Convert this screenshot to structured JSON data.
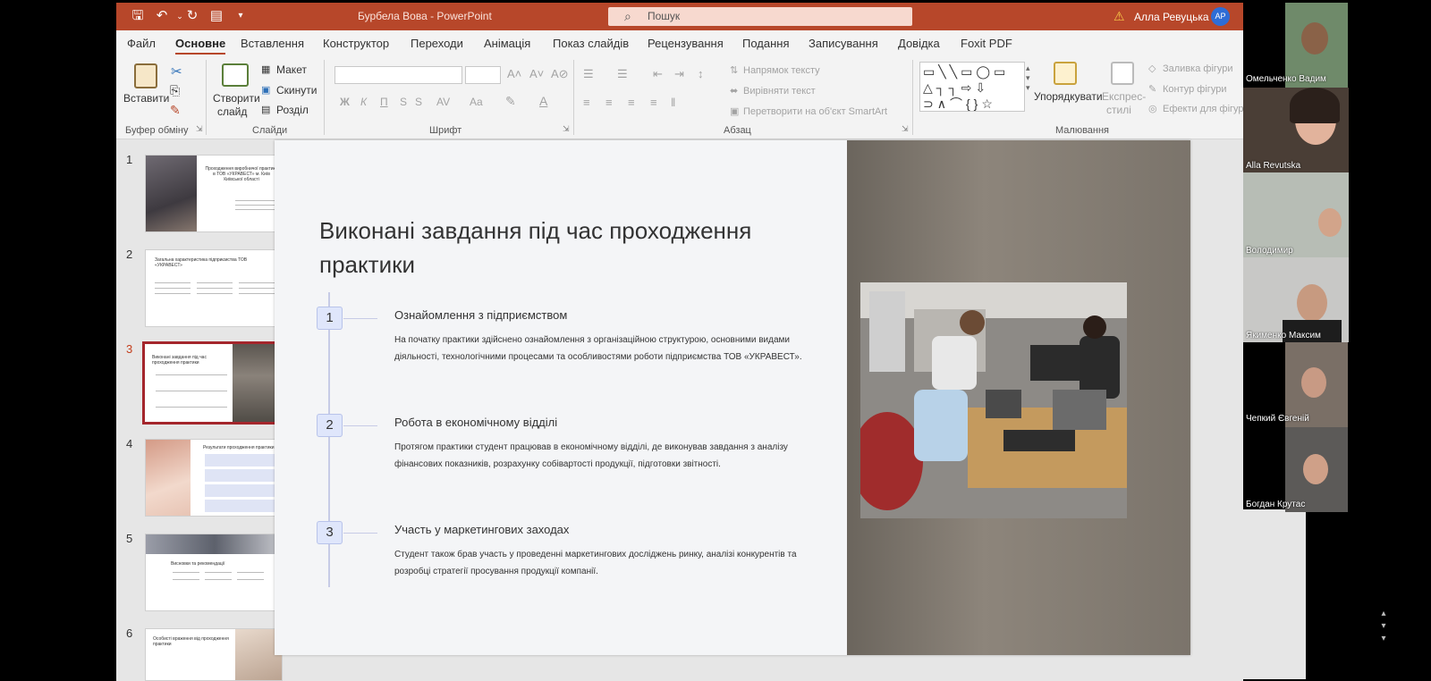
{
  "titlebar": {
    "doc_title": "Бурбела Вова  -  PowerPoint",
    "search_placeholder": "Пошук",
    "user_name": "Алла Ревуцька",
    "user_initials": "АР",
    "color": "#b7472a"
  },
  "quick_access": [
    "save-icon",
    "undo-icon",
    "redo-icon",
    "present-icon",
    "customize-icon"
  ],
  "menu_tabs": [
    "Файл",
    "Основне",
    "Вставлення",
    "Конструктор",
    "Переходи",
    "Анімація",
    "Показ слайдів",
    "Рецензування",
    "Подання",
    "Записування",
    "Довідка",
    "Foxit PDF"
  ],
  "active_tab": "Основне",
  "ribbon": {
    "clipboard": {
      "paste": "Вставити",
      "group": "Буфер обміну"
    },
    "slides": {
      "new_slide_1": "Створити",
      "new_slide_2": "слайд",
      "layout": "Макет",
      "reset": "Скинути",
      "section": "Розділ",
      "group": "Слайди"
    },
    "font": {
      "bold": "Ж",
      "italic": "К",
      "underline": "П",
      "strike": "S",
      "spacing": "AV",
      "case": "Aa",
      "group": "Шрифт"
    },
    "paragraph": {
      "direction": "Напрямок тексту",
      "align": "Вирівняти текст",
      "smartart": "Перетворити на об'єкт SmartArt",
      "group": "Абзац"
    },
    "drawing": {
      "arrange": "Упорядкувати",
      "quick_styles_1": "Експрес-",
      "quick_styles_2": "стилі",
      "fill": "Заливка фігури",
      "outline": "Контур фігури",
      "effects": "Ефекти для фігур",
      "group": "Малювання"
    }
  },
  "thumbnails": [
    {
      "num": "1",
      "title": "Проходження виробничої практики в ТОВ «УКРАВЕСТ» м. Київ Київської області"
    },
    {
      "num": "2",
      "title": "Загальна характеристика підприємства ТОВ «УКРАВЕСТ»"
    },
    {
      "num": "3",
      "title": "Виконані завдання під час проходження практики"
    },
    {
      "num": "4",
      "title": "Результати проходження практики"
    },
    {
      "num": "5",
      "title": "Висновки та рекомендації"
    },
    {
      "num": "6",
      "title": "Особисті враження від проходження практики"
    }
  ],
  "active_slide": "3",
  "slide": {
    "title": "Виконані завдання під час проходження практики",
    "steps": [
      {
        "num": "1",
        "heading": "Ознайомлення з підприємством",
        "body": "На початку практики здійснено ознайомлення з організаційною структурою, основними видами діяльності, технологічними процесами та особливостями роботи підприємства ТОВ «УКРАВЕСТ»."
      },
      {
        "num": "2",
        "heading": "Робота в економічному відділі",
        "body": "Протягом практики студент працював в економічному відділі, де виконував завдання з аналізу фінансових показників, розрахунку собівартості продукції, підготовки звітності."
      },
      {
        "num": "3",
        "heading": "Участь у маркетингових заходах",
        "body": "Студент також брав участь у проведенні маркетингових досліджень ринку, аналізі конкурентів та розробці стратегії просування продукції компанії."
      }
    ]
  },
  "participants": [
    "Омельченко Вадим",
    "Alla Revutska",
    "Володимир",
    "Якименко Максим",
    "Чепкий Євгеній",
    "Богдан Крутас"
  ]
}
